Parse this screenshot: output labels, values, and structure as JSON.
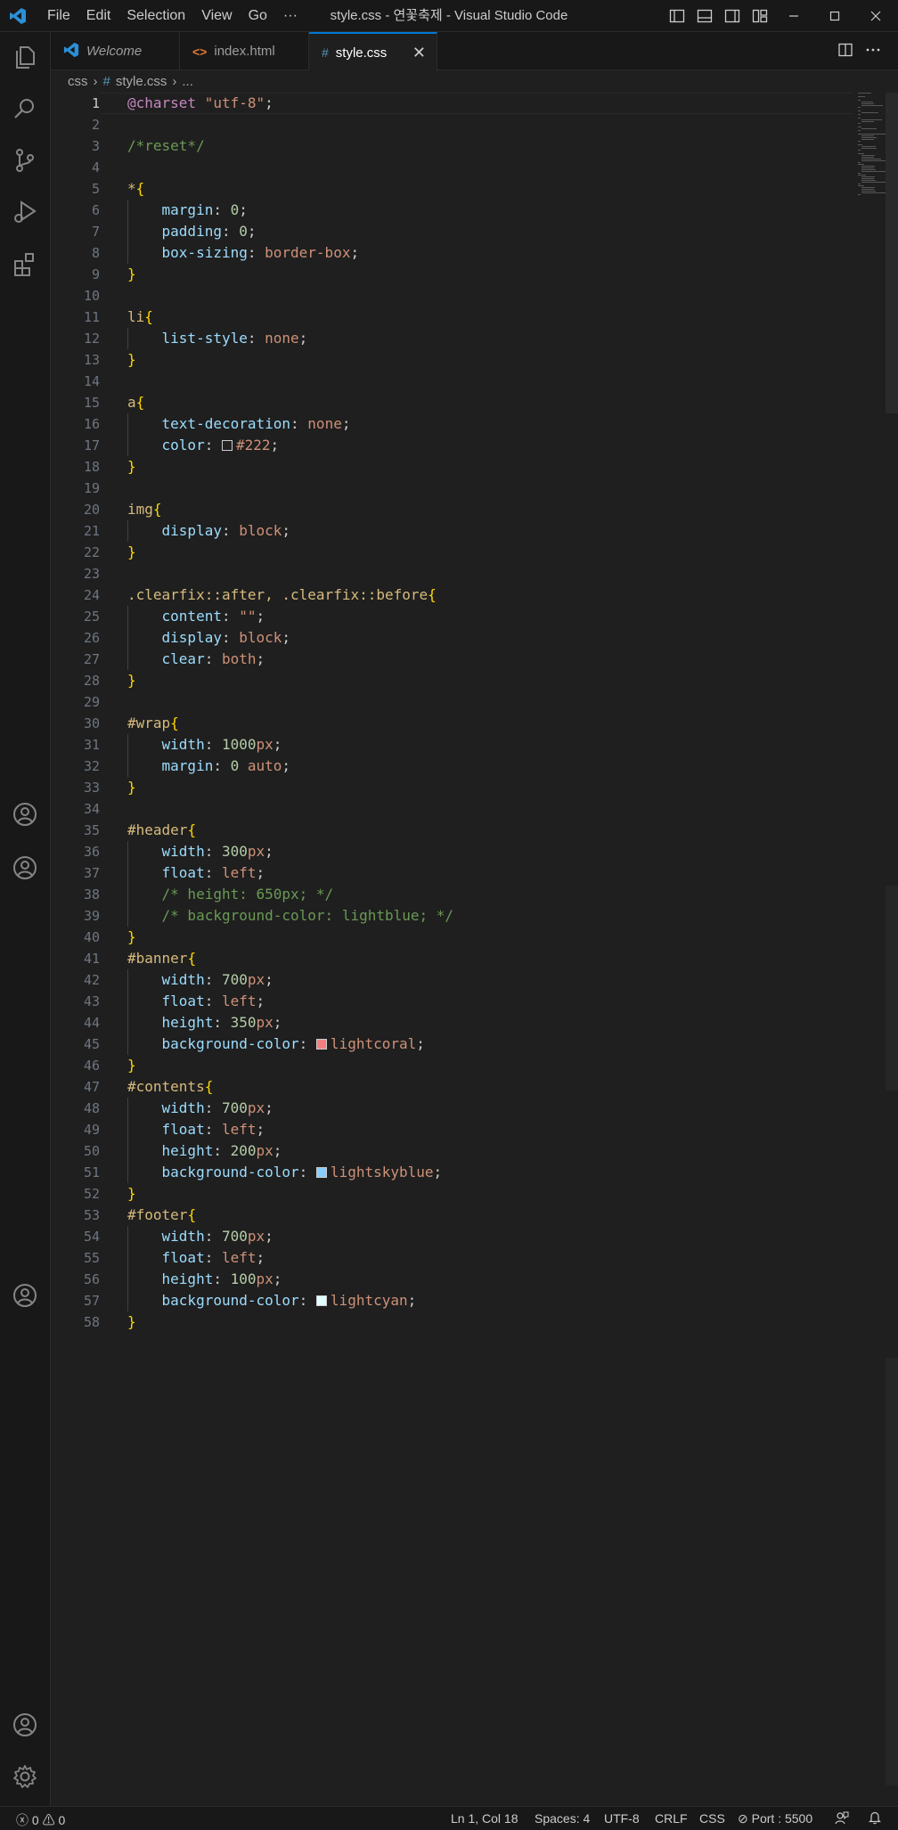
{
  "window": {
    "title": "style.css - 연꽃축제 - Visual Studio Code",
    "menu": [
      "File",
      "Edit",
      "Selection",
      "View",
      "Go",
      "···"
    ]
  },
  "tabs": [
    {
      "label": "Welcome",
      "icon": "vscode-icon",
      "italic": true
    },
    {
      "label": "index.html",
      "icon": "html-icon",
      "italic": false
    },
    {
      "label": "style.css",
      "icon": "css-hash-icon",
      "italic": false,
      "active": true
    }
  ],
  "breadcrumb": {
    "folder": "css",
    "file_icon": "#",
    "file": "style.css",
    "tail": "..."
  },
  "editor": {
    "current_line": 1,
    "line_numbers": [
      "1",
      "2",
      "3",
      "4",
      "5",
      "6",
      "7",
      "8",
      "9",
      "10",
      "11",
      "12",
      "13",
      "14",
      "15",
      "16",
      "17",
      "18",
      "19",
      "20",
      "21",
      "22",
      "23",
      "24",
      "25",
      "26",
      "27",
      "28",
      "29",
      "30",
      "31",
      "32",
      "33",
      "34",
      "35",
      "36",
      "37",
      "38",
      "39",
      "40",
      "41",
      "42",
      "43",
      "44",
      "45",
      "46",
      "47",
      "48",
      "49",
      "50",
      "51",
      "52",
      "53",
      "54",
      "55",
      "56",
      "57",
      "58"
    ],
    "lines": [
      [
        {
          "t": "@charset ",
          "c": "at"
        },
        {
          "t": "\"utf-8\"",
          "c": "str"
        },
        {
          "t": ";"
        }
      ],
      [],
      [
        {
          "t": "/*reset*/",
          "c": "cmt"
        }
      ],
      [],
      [
        {
          "t": "*",
          "c": "sel"
        },
        {
          "t": "{",
          "c": "brace"
        }
      ],
      [
        {
          "t": "    "
        },
        {
          "t": "margin",
          "c": "prop"
        },
        {
          "t": ": "
        },
        {
          "t": "0",
          "c": "num"
        },
        {
          "t": ";"
        }
      ],
      [
        {
          "t": "    "
        },
        {
          "t": "padding",
          "c": "prop"
        },
        {
          "t": ": "
        },
        {
          "t": "0",
          "c": "num"
        },
        {
          "t": ";"
        }
      ],
      [
        {
          "t": "    "
        },
        {
          "t": "box-sizing",
          "c": "prop"
        },
        {
          "t": ": "
        },
        {
          "t": "border-box",
          "c": "val"
        },
        {
          "t": ";"
        }
      ],
      [
        {
          "t": "}",
          "c": "brace"
        }
      ],
      [],
      [
        {
          "t": "li",
          "c": "sel"
        },
        {
          "t": "{",
          "c": "brace"
        }
      ],
      [
        {
          "t": "    "
        },
        {
          "t": "list-style",
          "c": "prop"
        },
        {
          "t": ": "
        },
        {
          "t": "none",
          "c": "val"
        },
        {
          "t": ";"
        }
      ],
      [
        {
          "t": "}",
          "c": "brace"
        }
      ],
      [],
      [
        {
          "t": "a",
          "c": "sel"
        },
        {
          "t": "{",
          "c": "brace"
        }
      ],
      [
        {
          "t": "    "
        },
        {
          "t": "text-decoration",
          "c": "prop"
        },
        {
          "t": ": "
        },
        {
          "t": "none",
          "c": "val"
        },
        {
          "t": ";"
        }
      ],
      [
        {
          "t": "    "
        },
        {
          "t": "color",
          "c": "prop"
        },
        {
          "t": ": "
        },
        {
          "swatch": "#222222"
        },
        {
          "t": "#222",
          "c": "val"
        },
        {
          "t": ";"
        }
      ],
      [
        {
          "t": "}",
          "c": "brace"
        }
      ],
      [],
      [
        {
          "t": "img",
          "c": "sel"
        },
        {
          "t": "{",
          "c": "brace"
        }
      ],
      [
        {
          "t": "    "
        },
        {
          "t": "display",
          "c": "prop"
        },
        {
          "t": ": "
        },
        {
          "t": "block",
          "c": "val"
        },
        {
          "t": ";"
        }
      ],
      [
        {
          "t": "}",
          "c": "brace"
        }
      ],
      [],
      [
        {
          "t": ".clearfix::after, .clearfix::before",
          "c": "sel"
        },
        {
          "t": "{",
          "c": "brace"
        }
      ],
      [
        {
          "t": "    "
        },
        {
          "t": "content",
          "c": "prop"
        },
        {
          "t": ": "
        },
        {
          "t": "\"\"",
          "c": "str"
        },
        {
          "t": ";"
        }
      ],
      [
        {
          "t": "    "
        },
        {
          "t": "display",
          "c": "prop"
        },
        {
          "t": ": "
        },
        {
          "t": "block",
          "c": "val"
        },
        {
          "t": ";"
        }
      ],
      [
        {
          "t": "    "
        },
        {
          "t": "clear",
          "c": "prop"
        },
        {
          "t": ": "
        },
        {
          "t": "both",
          "c": "val"
        },
        {
          "t": ";"
        }
      ],
      [
        {
          "t": "}",
          "c": "brace"
        }
      ],
      [],
      [
        {
          "t": "#wrap",
          "c": "sel"
        },
        {
          "t": "{",
          "c": "brace"
        }
      ],
      [
        {
          "t": "    "
        },
        {
          "t": "width",
          "c": "prop"
        },
        {
          "t": ": "
        },
        {
          "t": "1000",
          "c": "num"
        },
        {
          "t": "px",
          "c": "val"
        },
        {
          "t": ";"
        }
      ],
      [
        {
          "t": "    "
        },
        {
          "t": "margin",
          "c": "prop"
        },
        {
          "t": ": "
        },
        {
          "t": "0",
          "c": "num"
        },
        {
          "t": " auto",
          "c": "val"
        },
        {
          "t": ";"
        }
      ],
      [
        {
          "t": "}",
          "c": "brace"
        }
      ],
      [],
      [
        {
          "t": "#header",
          "c": "sel"
        },
        {
          "t": "{",
          "c": "brace"
        }
      ],
      [
        {
          "t": "    "
        },
        {
          "t": "width",
          "c": "prop"
        },
        {
          "t": ": "
        },
        {
          "t": "300",
          "c": "num"
        },
        {
          "t": "px",
          "c": "val"
        },
        {
          "t": ";"
        }
      ],
      [
        {
          "t": "    "
        },
        {
          "t": "float",
          "c": "prop"
        },
        {
          "t": ": "
        },
        {
          "t": "left",
          "c": "val"
        },
        {
          "t": ";"
        }
      ],
      [
        {
          "t": "    "
        },
        {
          "t": "/* height: 650px; */",
          "c": "cmt"
        }
      ],
      [
        {
          "t": "    "
        },
        {
          "t": "/* background-color: lightblue; */",
          "c": "cmt"
        }
      ],
      [
        {
          "t": "}",
          "c": "brace"
        }
      ],
      [
        {
          "t": "#banner",
          "c": "sel"
        },
        {
          "t": "{",
          "c": "brace"
        }
      ],
      [
        {
          "t": "    "
        },
        {
          "t": "width",
          "c": "prop"
        },
        {
          "t": ": "
        },
        {
          "t": "700",
          "c": "num"
        },
        {
          "t": "px",
          "c": "val"
        },
        {
          "t": ";"
        }
      ],
      [
        {
          "t": "    "
        },
        {
          "t": "float",
          "c": "prop"
        },
        {
          "t": ": "
        },
        {
          "t": "left",
          "c": "val"
        },
        {
          "t": ";"
        }
      ],
      [
        {
          "t": "    "
        },
        {
          "t": "height",
          "c": "prop"
        },
        {
          "t": ": "
        },
        {
          "t": "350",
          "c": "num"
        },
        {
          "t": "px",
          "c": "val"
        },
        {
          "t": ";"
        }
      ],
      [
        {
          "t": "    "
        },
        {
          "t": "background-color",
          "c": "prop"
        },
        {
          "t": ": "
        },
        {
          "swatch": "#f08080"
        },
        {
          "t": "lightcoral",
          "c": "val"
        },
        {
          "t": ";"
        }
      ],
      [
        {
          "t": "}",
          "c": "brace"
        }
      ],
      [
        {
          "t": "#contents",
          "c": "sel"
        },
        {
          "t": "{",
          "c": "brace"
        }
      ],
      [
        {
          "t": "    "
        },
        {
          "t": "width",
          "c": "prop"
        },
        {
          "t": ": "
        },
        {
          "t": "700",
          "c": "num"
        },
        {
          "t": "px",
          "c": "val"
        },
        {
          "t": ";"
        }
      ],
      [
        {
          "t": "    "
        },
        {
          "t": "float",
          "c": "prop"
        },
        {
          "t": ": "
        },
        {
          "t": "left",
          "c": "val"
        },
        {
          "t": ";"
        }
      ],
      [
        {
          "t": "    "
        },
        {
          "t": "height",
          "c": "prop"
        },
        {
          "t": ": "
        },
        {
          "t": "200",
          "c": "num"
        },
        {
          "t": "px",
          "c": "val"
        },
        {
          "t": ";"
        }
      ],
      [
        {
          "t": "    "
        },
        {
          "t": "background-color",
          "c": "prop"
        },
        {
          "t": ": "
        },
        {
          "swatch": "#87cefa"
        },
        {
          "t": "lightskyblue",
          "c": "val"
        },
        {
          "t": ";"
        }
      ],
      [
        {
          "t": "}",
          "c": "brace"
        }
      ],
      [
        {
          "t": "#footer",
          "c": "sel"
        },
        {
          "t": "{",
          "c": "brace"
        }
      ],
      [
        {
          "t": "    "
        },
        {
          "t": "width",
          "c": "prop"
        },
        {
          "t": ": "
        },
        {
          "t": "700",
          "c": "num"
        },
        {
          "t": "px",
          "c": "val"
        },
        {
          "t": ";"
        }
      ],
      [
        {
          "t": "    "
        },
        {
          "t": "float",
          "c": "prop"
        },
        {
          "t": ": "
        },
        {
          "t": "left",
          "c": "val"
        },
        {
          "t": ";"
        }
      ],
      [
        {
          "t": "    "
        },
        {
          "t": "height",
          "c": "prop"
        },
        {
          "t": ": "
        },
        {
          "t": "100",
          "c": "num"
        },
        {
          "t": "px",
          "c": "val"
        },
        {
          "t": ";"
        }
      ],
      [
        {
          "t": "    "
        },
        {
          "t": "background-color",
          "c": "prop"
        },
        {
          "t": ": "
        },
        {
          "swatch": "#e0ffff"
        },
        {
          "t": "lightcyan",
          "c": "val"
        },
        {
          "t": ";"
        }
      ],
      [
        {
          "t": "}",
          "c": "brace"
        }
      ]
    ]
  },
  "statusbar": {
    "problems_errors": "0",
    "problems_warnings": "0",
    "position": "Ln 1, Col 18",
    "spaces": "Spaces: 4",
    "encoding": "UTF-8",
    "eol": "CRLF",
    "language": "CSS",
    "port": "Port : 5500"
  },
  "colors": {
    "accent": "#0078d4",
    "editor_bg": "#1f1f1f",
    "chrome_bg": "#181818"
  }
}
